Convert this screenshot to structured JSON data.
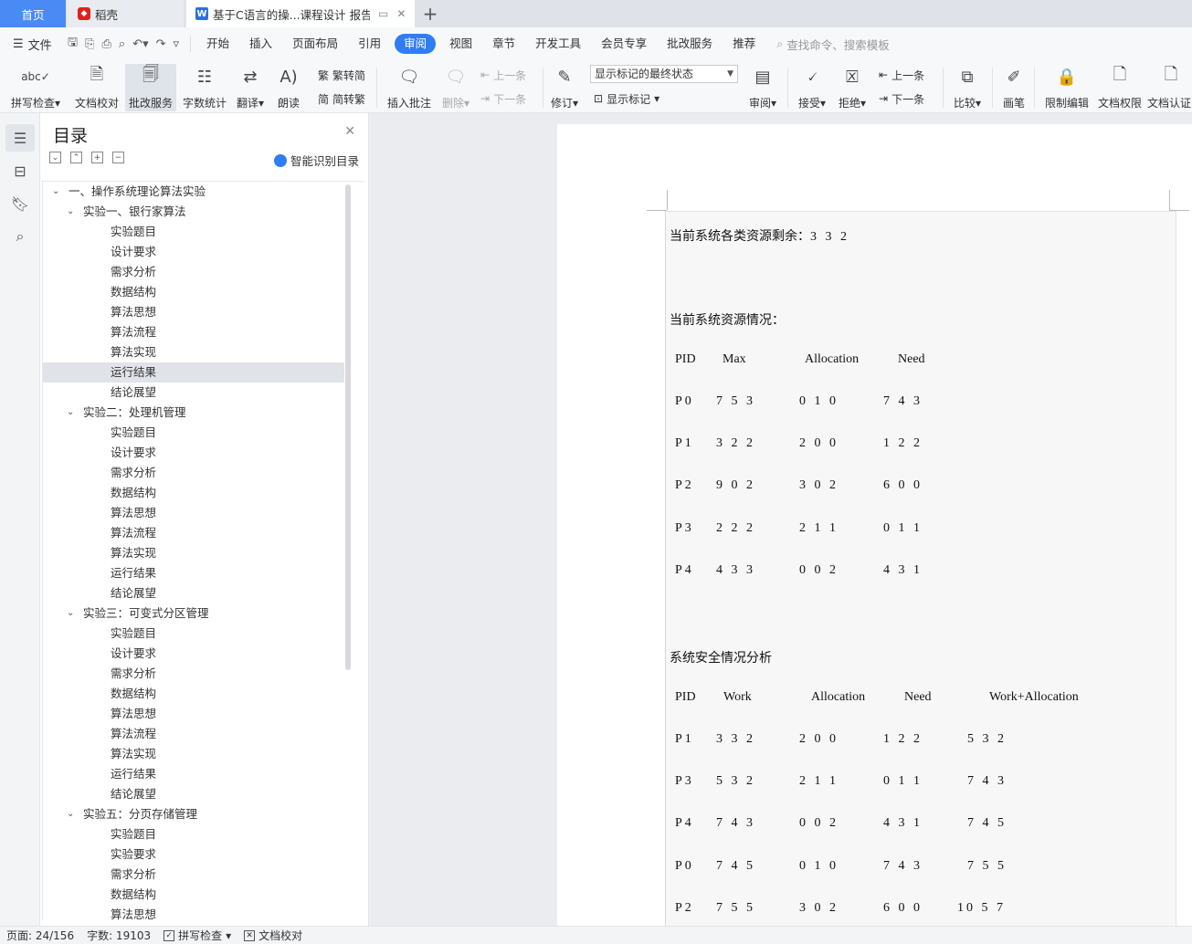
{
  "tabs": {
    "home": "首页",
    "daoke": "稻壳",
    "doc": "基于C语言的操...课程设计 报告",
    "add": "+"
  },
  "menubar": {
    "file": "文件",
    "items": [
      "开始",
      "插入",
      "页面布局",
      "引用",
      "审阅",
      "视图",
      "章节",
      "开发工具",
      "会员专享",
      "批改服务",
      "推荐"
    ],
    "active": "审阅",
    "search": "查找命令、搜索模板"
  },
  "ribbon": {
    "spell_check": "拼写检查",
    "doc_proof": "文档校对",
    "correction_service": "批改服务",
    "word_count": "字数统计",
    "translate": "翻译",
    "read_aloud": "朗读",
    "trad_to_simp": "繁转简",
    "simp_to_trad": "简转繁",
    "insert_comment": "插入批注",
    "delete": "删除",
    "prev_comment": "上一条",
    "next_comment": "下一条",
    "track_changes": "修订",
    "markup_state": "显示标记的最终状态",
    "show_markup": "显示标记",
    "review": "审阅",
    "accept": "接受",
    "reject": "拒绝",
    "prev_change": "上一条",
    "next_change": "下一条",
    "compare": "比较",
    "pen": "画笔",
    "restrict_edit": "限制编辑",
    "doc_permission": "文档权限",
    "doc_cert": "文档认证"
  },
  "toc": {
    "title": "目录",
    "smart": "智能识别目录",
    "items": [
      {
        "text": "一、操作系统理论算法实验",
        "level": 0
      },
      {
        "text": "实验一、银行家算法",
        "level": 1
      },
      {
        "text": "实验题目",
        "level": 2
      },
      {
        "text": "设计要求",
        "level": 2
      },
      {
        "text": "需求分析",
        "level": 2
      },
      {
        "text": "数据结构",
        "level": 2
      },
      {
        "text": "算法思想",
        "level": 2
      },
      {
        "text": "算法流程",
        "level": 2
      },
      {
        "text": "算法实现",
        "level": 2
      },
      {
        "text": "运行结果",
        "level": 2,
        "selected": true
      },
      {
        "text": "结论展望",
        "level": 2
      },
      {
        "text": "实验二：处理机管理",
        "level": 1
      },
      {
        "text": "实验题目",
        "level": 2
      },
      {
        "text": "设计要求",
        "level": 2
      },
      {
        "text": "需求分析",
        "level": 2
      },
      {
        "text": "数据结构",
        "level": 2
      },
      {
        "text": "算法思想",
        "level": 2
      },
      {
        "text": "算法流程",
        "level": 2
      },
      {
        "text": "算法实现",
        "level": 2
      },
      {
        "text": "运行结果",
        "level": 2
      },
      {
        "text": "结论展望",
        "level": 2
      },
      {
        "text": "实验三：可变式分区管理",
        "level": 1
      },
      {
        "text": "实验题目",
        "level": 2
      },
      {
        "text": "设计要求",
        "level": 2
      },
      {
        "text": "需求分析",
        "level": 2
      },
      {
        "text": "数据结构",
        "level": 2
      },
      {
        "text": "算法思想",
        "level": 2
      },
      {
        "text": "算法流程",
        "level": 2
      },
      {
        "text": "算法实现",
        "level": 2
      },
      {
        "text": "运行结果",
        "level": 2
      },
      {
        "text": "结论展望",
        "level": 2
      },
      {
        "text": "实验五：分页存储管理",
        "level": 1
      },
      {
        "text": "实验题目",
        "level": 2
      },
      {
        "text": "实验要求",
        "level": 2
      },
      {
        "text": "需求分析",
        "level": 2
      },
      {
        "text": "数据结构",
        "level": 2
      },
      {
        "text": "算法思想",
        "level": 2
      }
    ]
  },
  "document": {
    "remaining_label": "当前系统各类资源剩余：",
    "remaining_value": "3 3 2",
    "status_title": "当前系统资源情况：",
    "table1": {
      "headers": [
        "PID",
        "Max",
        "Allocation",
        "Need"
      ],
      "rows": [
        [
          "P0",
          "7 5 3",
          "0 1 0",
          "7 4 3"
        ],
        [
          "P1",
          "3 2 2",
          "2 0 0",
          "1 2 2"
        ],
        [
          "P2",
          "9 0 2",
          "3 0 2",
          "6 0 0"
        ],
        [
          "P3",
          "2 2 2",
          "2 1 1",
          "0 1 1"
        ],
        [
          "P4",
          "4 3 3",
          "0 0 2",
          "4 3 1"
        ]
      ]
    },
    "safety_title": "系统安全情况分析",
    "table2": {
      "headers": [
        "PID",
        "Work",
        "Allocation",
        "Need",
        "Work+Allocation"
      ],
      "rows": [
        [
          "P1",
          "3 3 2",
          "2 0 0",
          "1 2 2",
          "5 3 2"
        ],
        [
          "P3",
          "5 3 2",
          "2 1 1",
          "0 1 1",
          "7 4 3"
        ],
        [
          "P4",
          "7 4 3",
          "0 0 2",
          "4 3 1",
          "7 4 5"
        ],
        [
          "P0",
          "7 4 5",
          "0 1 0",
          "7 4 3",
          "7 5 5"
        ],
        [
          "P2",
          "7 5 5",
          "3 0 2",
          "6 0 0",
          "10 5 7"
        ]
      ]
    }
  },
  "status": {
    "page": "页面: 24/156",
    "words": "字数: 19103",
    "spell": "拼写检查",
    "proof": "文档校对"
  }
}
